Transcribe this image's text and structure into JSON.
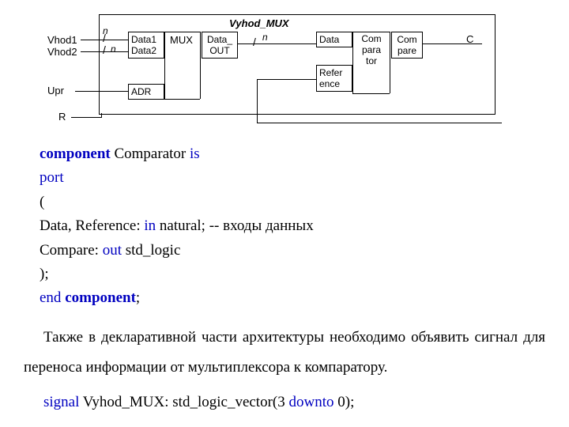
{
  "diagram": {
    "title": "Vyhod_MUX",
    "inputs": {
      "in1": "Vhod1",
      "in2": "Vhod2",
      "upr": "Upr",
      "r": "R"
    },
    "n1": "n",
    "n2": "n",
    "n3": "n",
    "mux": {
      "d1": "Data1",
      "d2": "Data2",
      "name": "MUX",
      "out": "Data_\nOUT",
      "adr": "ADR"
    },
    "comp": {
      "data": "Data",
      "ref": "Refer\nence",
      "name": "Com\npara\ntor",
      "out": "Com\npare"
    },
    "c": "C"
  },
  "code": {
    "l1a": "component",
    "l1b": " Comparator ",
    "l1c": "is",
    "l2": "port",
    "l3": "(",
    "l4a": "Data, Reference: ",
    "l4b": "in",
    "l4c": " natural; -- входы данных",
    "l5a": "Compare: ",
    "l5b": "out",
    "l5c": "  std_logic",
    "l6": ");",
    "l7a": "end",
    "l7b": " ",
    "l7c": "component",
    "l7d": ";"
  },
  "para1": "Также в декларативной части архитектуры необходимо объявить сигнал для переноса информации от мультиплексора к компаратору.",
  "sig": {
    "a": "signal",
    "b": " Vyhod_MUX: std_logic_vector(3 ",
    "c": "downto",
    "d": " 0);"
  }
}
